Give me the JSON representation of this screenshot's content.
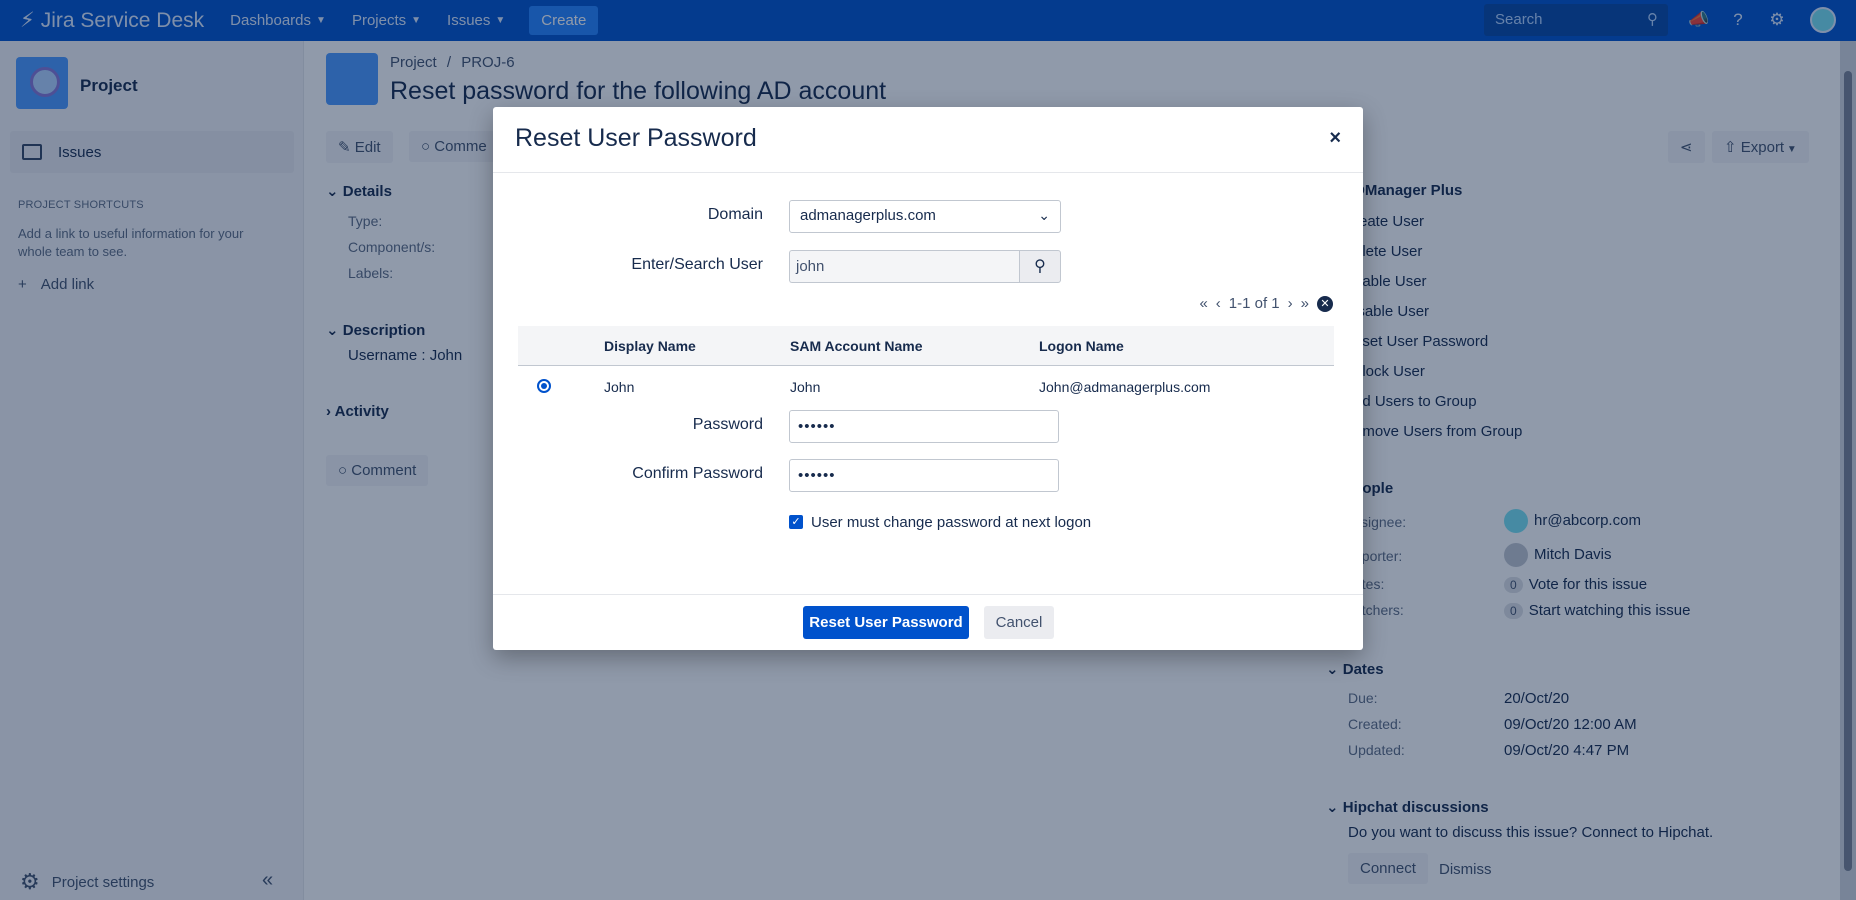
{
  "topnav": {
    "brand": "Jira Service Desk",
    "menus": [
      "Dashboards",
      "Projects",
      "Issues"
    ],
    "create_label": "Create",
    "search_placeholder": "Search"
  },
  "sidebar": {
    "project_name": "Project",
    "issues_label": "Issues",
    "shortcuts_title": "PROJECT SHORTCUTS",
    "shortcuts_desc": "Add a link to useful information for your whole team to see.",
    "add_link": "Add link",
    "settings_label": "Project settings"
  },
  "issue": {
    "breadcrumb_project": "Project",
    "breadcrumb_sep": "/",
    "breadcrumb_key": "PROJ-6",
    "title": "Reset password for the following AD account",
    "edit_label": "Edit",
    "comment_top_label": "Comme",
    "details_label": "Details",
    "type_label": "Type:",
    "component_label": "Component/s:",
    "labels_label": "Labels:",
    "description_label": "Description",
    "description_text": "Username : John",
    "activity_label": "Activity",
    "comment_label": "Comment",
    "export_label": "Export"
  },
  "right_panel": {
    "admanager_title": "DManager Plus",
    "links": [
      "reate User",
      "elete User",
      "nable User",
      "isable User",
      "eset User Password",
      "nlock User",
      "dd Users to Group",
      "emove Users from Group"
    ],
    "people_title": "eople",
    "assignee_label": "ssignee:",
    "assignee_value": "hr@abcorp.com",
    "reporter_label": "eporter:",
    "reporter_value": "Mitch Davis",
    "votes_label": "otes:",
    "votes_count": "0",
    "votes_value": "Vote for this issue",
    "watchers_label": "atchers:",
    "watchers_count": "0",
    "watchers_value": "Start watching this issue",
    "dates_title": "Dates",
    "due_label": "Due:",
    "due_value": "20/Oct/20",
    "created_label": "Created:",
    "created_value": "09/Oct/20 12:00 AM",
    "updated_label": "Updated:",
    "updated_value": "09/Oct/20 4:47 PM",
    "hipchat_title": "Hipchat discussions",
    "hipchat_text": "Do you want to discuss this issue? Connect to Hipchat.",
    "connect_label": "Connect",
    "dismiss_label": "Dismiss"
  },
  "modal": {
    "title": "Reset User Password",
    "close": "×",
    "domain_label": "Domain",
    "domain_value": "admanagerplus.com",
    "search_label": "Enter/Search User",
    "search_value": "john",
    "pager_text": "1-1 of 1",
    "columns": [
      "Display Name",
      "SAM Account Name",
      "Logon Name"
    ],
    "row": {
      "display": "John",
      "sam": "John",
      "logon": "John@admanagerplus.com"
    },
    "password_label": "Password",
    "password_value": "••••••",
    "confirm_label": "Confirm Password",
    "confirm_value": "••••••",
    "checkbox_label": "User must change password at next logon",
    "submit_label": "Reset User Password",
    "cancel_label": "Cancel"
  }
}
